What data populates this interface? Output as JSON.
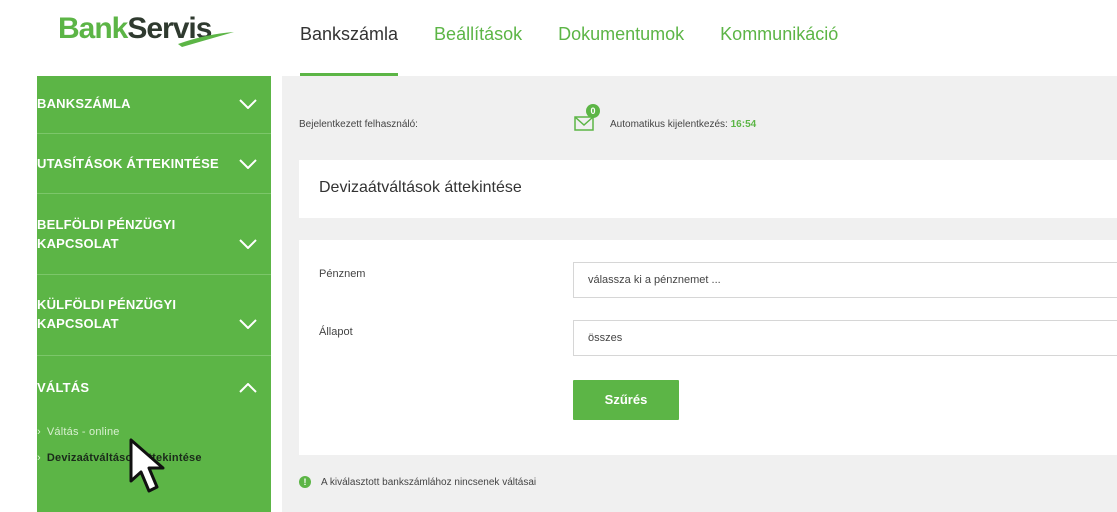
{
  "brand": {
    "part1": "Bank",
    "part2": "Servis"
  },
  "nav": {
    "tabs": [
      {
        "label": "Bankszámla",
        "active": true
      },
      {
        "label": "Beállítások",
        "active": false
      },
      {
        "label": "Dokumentumok",
        "active": false
      },
      {
        "label": "Kommunikáció",
        "active": false
      }
    ]
  },
  "sidebar": {
    "items": [
      {
        "label": "BANKSZÁMLA",
        "state": "collapsed"
      },
      {
        "label": "UTASÍTÁSOK ÁTTEKINTÉSE",
        "state": "collapsed"
      },
      {
        "label_line1": "BELFÖLDI PÉNZÜGYI",
        "label_line2": "KAPCSOLAT",
        "state": "collapsed"
      },
      {
        "label_line1": "KÜLFÖLDI PÉNZÜGYI",
        "label_line2": "KAPCSOLAT",
        "state": "collapsed"
      },
      {
        "label": "VÁLTÁS",
        "state": "expanded"
      }
    ],
    "subitems": [
      {
        "label": "Váltás - online",
        "active": false
      },
      {
        "label": "Devizaátváltások áttekintése",
        "active": true
      }
    ],
    "arrow": "›"
  },
  "status": {
    "user_label": "Bejelentkezett felhasználó:",
    "message_count": "0",
    "logout_label": "Automatikus kijelentkezés:",
    "logout_time": "16:54"
  },
  "panel": {
    "title": "Devizaátváltások áttekintése"
  },
  "form": {
    "currency_label": "Pénznem",
    "currency_value": "válassza ki a pénznemet ...",
    "status_label": "Állapot",
    "status_value": "összes",
    "filter_button": "Szűrés"
  },
  "info": {
    "icon": "!",
    "text": "A kiválasztott bankszámlához nincsenek váltásai"
  },
  "colors": {
    "brand_green": "#5cb546",
    "sidebar_green": "#5cb546",
    "main_bg": "#f0f0f0"
  },
  "icons": [
    "chevron-down-icon",
    "chevron-up-icon",
    "envelope-icon",
    "info-icon",
    "cursor-icon"
  ]
}
